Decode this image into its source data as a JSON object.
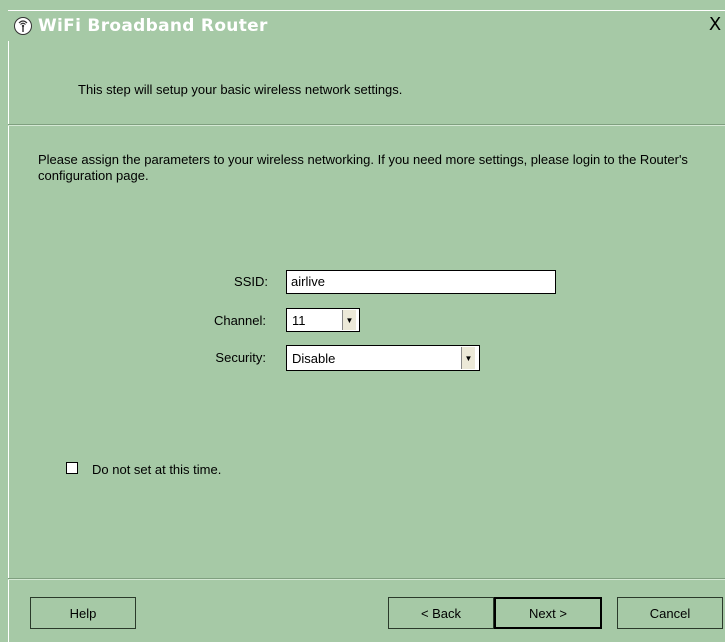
{
  "window": {
    "title": "WiFi Broadband Router",
    "close_symbol": "X",
    "icon": "router-antenna-icon"
  },
  "header": {
    "step_text": "This step will setup your basic wireless network settings."
  },
  "main": {
    "description": "Please assign the parameters to your wireless networking. If you need more settings, please login to the Router's configuration page.",
    "ssid": {
      "label": "SSID:",
      "value": "airlive"
    },
    "channel": {
      "label": "Channel:",
      "value": "11"
    },
    "security": {
      "label": "Security:",
      "value": "Disable"
    },
    "skip_checkbox": {
      "label": "Do not set at this time.",
      "checked": false
    }
  },
  "footer": {
    "help_label": "Help",
    "back_label": "< Back",
    "next_label": "Next >",
    "cancel_label": "Cancel"
  },
  "colors": {
    "background": "#a6c9a6",
    "title_text": "#ffffff"
  }
}
